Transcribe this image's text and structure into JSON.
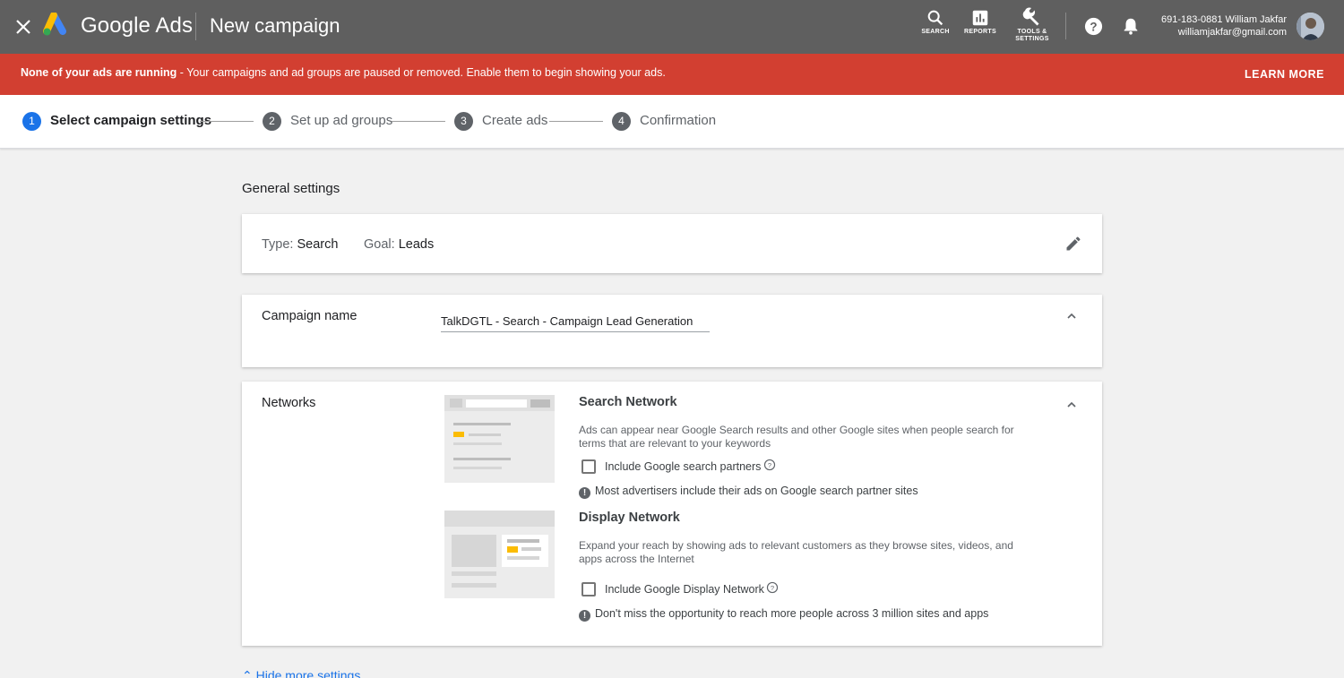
{
  "app": {
    "brand": "Google Ads",
    "page_title": "New campaign"
  },
  "toolbar": {
    "search_label": "SEARCH",
    "reports_label": "REPORTS",
    "tools_label_1": "TOOLS &",
    "tools_label_2": "SETTINGS"
  },
  "account": {
    "line1": "691-183-0881 William Jakfar",
    "email": "williamjakfar@gmail.com"
  },
  "alert": {
    "bold": "None of your ads are running",
    "text": " - Your campaigns and ad groups are paused or removed. Enable them to begin showing your ads.",
    "action": "LEARN MORE"
  },
  "stepper": {
    "steps": [
      {
        "num": "1",
        "label": "Select campaign settings"
      },
      {
        "num": "2",
        "label": "Set up ad groups"
      },
      {
        "num": "3",
        "label": "Create ads"
      },
      {
        "num": "4",
        "label": "Confirmation"
      }
    ]
  },
  "main": {
    "section_title": "General settings",
    "type_label": "Type:",
    "type_value": "Search",
    "goal_label": "Goal:",
    "goal_value": "Leads",
    "campaign_name_label": "Campaign name",
    "campaign_name_value": "TalkDGTL - Search - Campaign Lead Generation",
    "networks_label": "Networks",
    "search_network": {
      "title": "Search Network",
      "desc": "Ads can appear near Google Search results and other Google sites when people search for terms that are relevant to your keywords",
      "checkbox": "Include Google search partners",
      "checked": false,
      "note": "Most advertisers include their ads on Google search partner sites"
    },
    "display_network": {
      "title": "Display Network",
      "desc": "Expand your reach by showing ads to relevant customers as they browse sites, videos, and apps across the Internet",
      "checkbox": "Include Google Display Network",
      "checked": false,
      "note": "Don't miss the opportunity to reach more people across 3 million sites and apps"
    },
    "hide_more": "Hide more settings"
  },
  "colors": {
    "topbar": "#5f5f5f",
    "alert": "#d23f31",
    "accent": "#1a73e8",
    "illustration_yellow": "#fbbc04"
  },
  "icons": [
    "close-icon",
    "google-ads-logo",
    "search-icon",
    "reports-icon",
    "tools-icon",
    "help-icon",
    "bell-icon",
    "edit-icon",
    "chevron-up-icon",
    "help-outline-icon",
    "info-icon"
  ]
}
